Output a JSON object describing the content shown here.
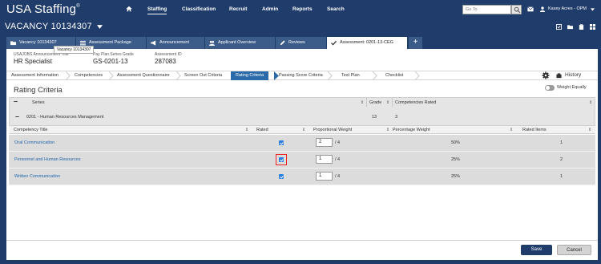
{
  "app": {
    "logo": "USA Staffing",
    "reg": "®"
  },
  "nav": {
    "items": [
      "Staffing",
      "Classification",
      "Recruit",
      "Admin",
      "Reports",
      "Search"
    ],
    "active": "Staffing"
  },
  "header": {
    "goto_placeholder": "Go To",
    "user": "Kasey Acres - OPM",
    "vacancy": "VACANCY 10134307"
  },
  "tabs": [
    {
      "label": "Vacancy 10134307",
      "icon": "folder-icon"
    },
    {
      "label": "Assessment Package",
      "icon": "list-icon"
    },
    {
      "label": "Announcement",
      "icon": "megaphone-icon"
    },
    {
      "label": "Applicant Overview",
      "icon": "people-icon"
    },
    {
      "label": "Reviews",
      "icon": "review-icon"
    },
    {
      "label": "Assessment: 0201-13-CEG",
      "icon": "check-icon"
    }
  ],
  "tooltip": "Vacancy 10134307",
  "info": {
    "title_label": "USAJOBS Announcement Title",
    "title_value": "HR Specialist",
    "grade_label": "Pay Plan Series Grade",
    "grade_value": "GS-0201-13",
    "id_label": "Assessment ID",
    "id_value": "287083"
  },
  "steps": [
    "Assessment Information",
    "Competencies",
    "Assessment Questionnaire",
    "Screen Out Criteria",
    "Rating Criteria",
    "Passing Score Criteria",
    "Test Plan",
    "Checklist"
  ],
  "active_step": "Rating Criteria",
  "history_label": "History",
  "section_title": "Rating Criteria",
  "weight_equally": "Weight Equally",
  "series_table": {
    "headers": {
      "series": "Series",
      "grade": "Grade",
      "competencies": "Competencies Rated"
    },
    "row": {
      "series": "0201 - Human Resources Management",
      "grade": "13",
      "competencies": "3"
    }
  },
  "criteria_table": {
    "headers": {
      "title": "Competency Title",
      "rated": "Rated",
      "prop": "Proportional Weight",
      "pct": "Percentage Weight",
      "items": "Rated Items"
    },
    "rows": [
      {
        "title": "Oral Communication",
        "weight": "2",
        "suffix": "/ 4",
        "pct": "50%",
        "items": "1"
      },
      {
        "title": "Personnel and Human Resources",
        "weight": "1",
        "suffix": "/ 4",
        "pct": "25%",
        "items": "2"
      },
      {
        "title": "Written Communication",
        "weight": "1",
        "suffix": "/ 4",
        "pct": "25%",
        "items": "1"
      }
    ]
  },
  "buttons": {
    "save": "Save",
    "cancel": "Cancel"
  },
  "colors": {
    "brand": "#1f3c6a",
    "active_step": "#2b6aa8",
    "link": "#2266aa",
    "highlight": "#e22222"
  }
}
